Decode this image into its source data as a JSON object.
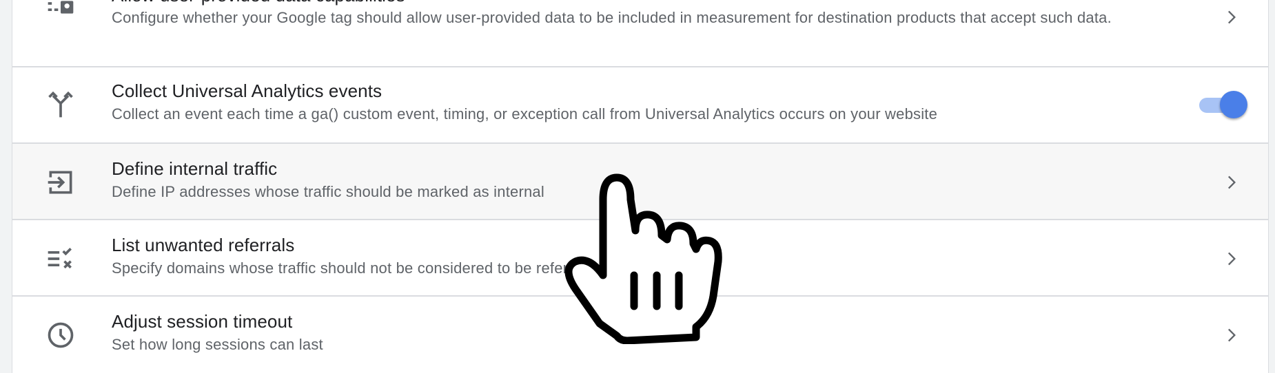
{
  "rows": [
    {
      "title": "Allow user-provided data capabilities",
      "desc": "Configure whether your Google tag should allow user-provided data to be included in measurement for destination products that accept such data.",
      "icon": "user-data-icon",
      "control": "chevron"
    },
    {
      "title": "Collect Universal Analytics events",
      "desc": "Collect an event each time a ga() custom event, timing, or exception call from Universal Analytics occurs on your website",
      "icon": "merge-arrows-icon",
      "control": "toggle",
      "toggle_on": true
    },
    {
      "title": "Define internal traffic",
      "desc": "Define IP addresses whose traffic should be marked as internal",
      "icon": "login-arrow-icon",
      "control": "chevron"
    },
    {
      "title": "List unwanted referrals",
      "desc": "Specify domains whose traffic should not be considered to be referrals",
      "icon": "list-remove-icon",
      "control": "chevron"
    },
    {
      "title": "Adjust session timeout",
      "desc": "Set how long sessions can last",
      "icon": "clock-icon",
      "control": "chevron"
    }
  ],
  "colors": {
    "accent": "#4a7fe8",
    "accent_track": "#a8c3f5",
    "text_primary": "#202124",
    "text_secondary": "#5f6368",
    "divider": "#dadce0"
  }
}
